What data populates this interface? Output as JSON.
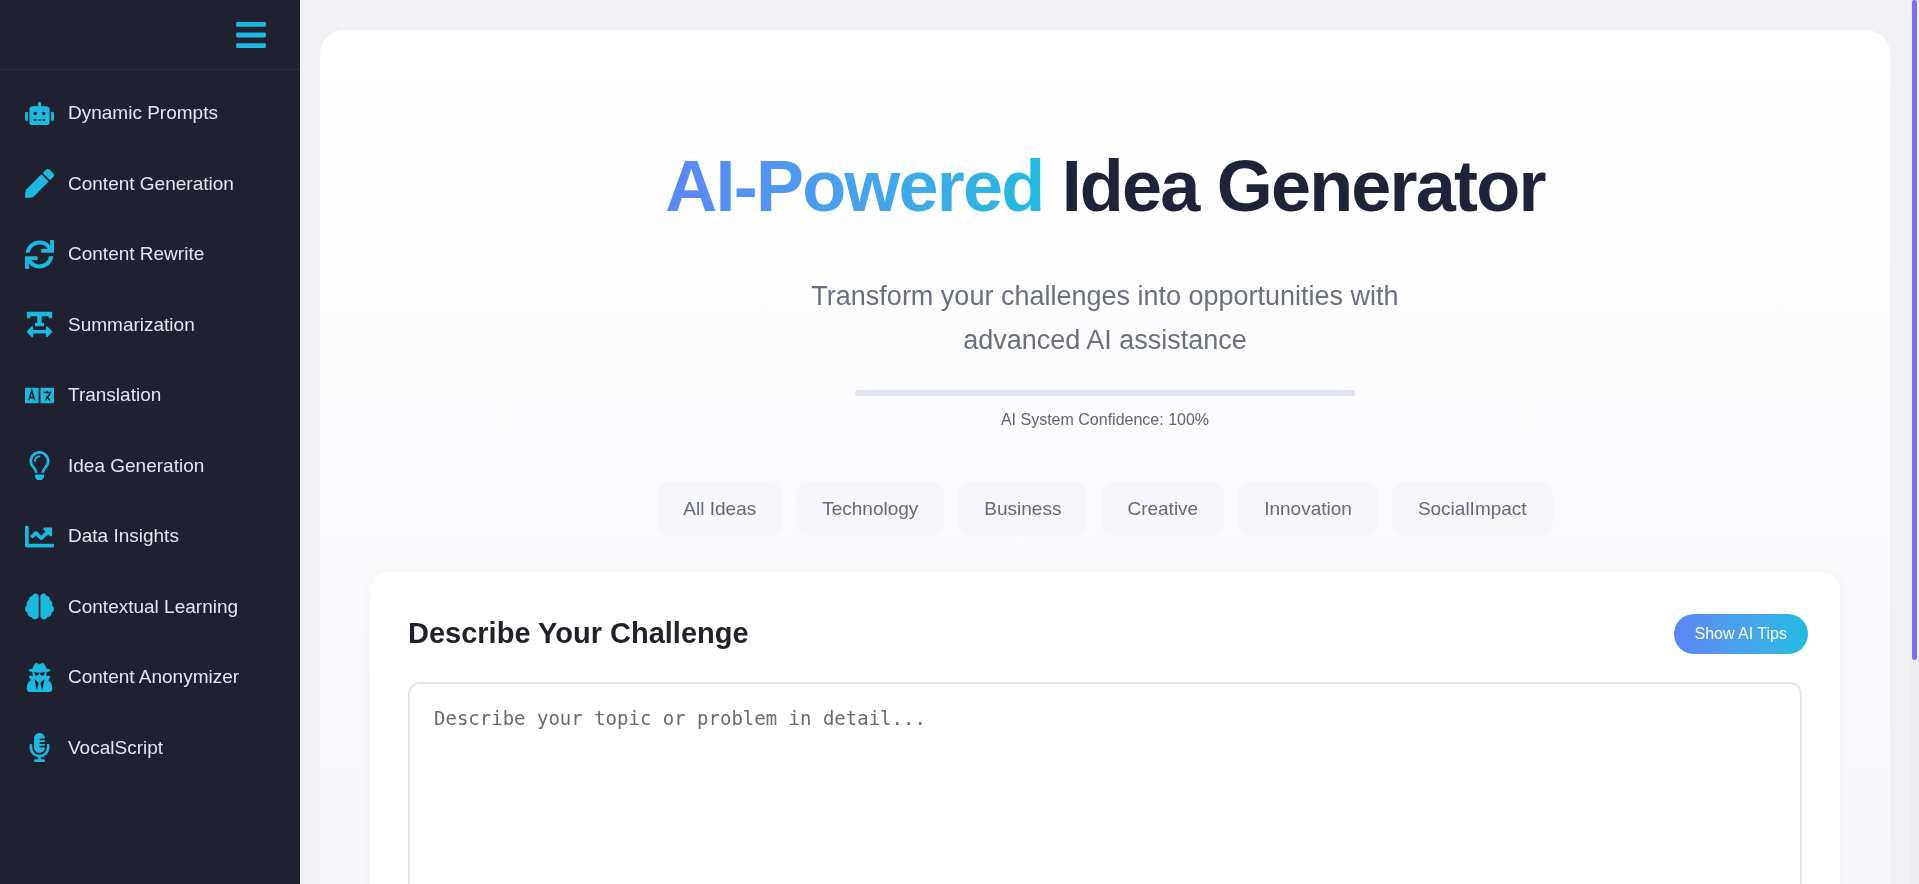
{
  "sidebar": {
    "items": [
      {
        "label": "Dynamic Prompts"
      },
      {
        "label": "Content Generation"
      },
      {
        "label": "Content Rewrite"
      },
      {
        "label": "Summarization"
      },
      {
        "label": "Translation"
      },
      {
        "label": "Idea Generation"
      },
      {
        "label": "Data Insights"
      },
      {
        "label": "Contextual Learning"
      },
      {
        "label": "Content Anonymizer"
      },
      {
        "label": "VocalScript"
      }
    ]
  },
  "hero": {
    "title_highlight": "AI-Powered",
    "title_rest": "Idea Generator",
    "subtitle": "Transform your challenges into opportunities with advanced AI assistance",
    "confidence": {
      "label": "AI System Confidence: 100%"
    }
  },
  "categories": [
    {
      "label": "All Ideas"
    },
    {
      "label": "Technology"
    },
    {
      "label": "Business"
    },
    {
      "label": "Creative"
    },
    {
      "label": "Innovation"
    },
    {
      "label": "SocialImpact"
    }
  ],
  "challenge": {
    "heading": "Describe Your Challenge",
    "tips_button": "Show AI Tips",
    "input": {
      "placeholder": "Describe your topic or problem in detail..."
    }
  }
}
